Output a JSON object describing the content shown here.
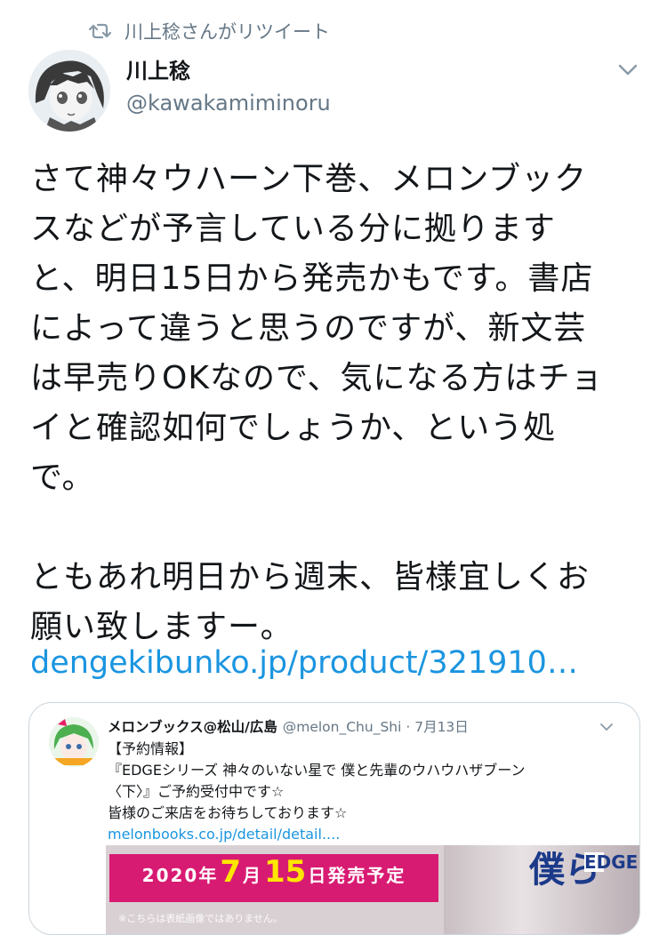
{
  "retweet": {
    "icon": "retweet-icon",
    "text": "川上稔さんがリツイート"
  },
  "author": {
    "name": "川上稔",
    "handle": "@kawakamiminoru",
    "avatar_icon": "anime-avatar"
  },
  "tweet": {
    "lines": [
      "さて神々ウハーン下巻、メロンブック",
      "スなどが予言している分に拠ります",
      "と、明日15日から発売かもです。書店",
      "によって違うと思うのですが、新文芸",
      "は早売りOKなので、気になる方はチョ",
      "イと確認如何でしょうか、という処",
      "で。",
      "",
      "ともあれ明日から週末、皆様宜しくお",
      "願い致しますー。"
    ],
    "link": "dengekibunko.jp/product/321910…"
  },
  "quote": {
    "name": "メロンブックス@松山/広島",
    "meta": "@melon_Chu_Shi · 7月13日",
    "lines": [
      "【予約情報】",
      "『EDGEシリーズ 神々のいない星で 僕と先輩のウハウハザブーン",
      "〈下〉』ご予約受付中です☆",
      "皆様のご来店をお待ちしております☆"
    ],
    "link": "melonbooks.co.jp/detail/detail....",
    "image": {
      "year": "2020年",
      "month": "7",
      "month_unit": "月",
      "day": "15",
      "day_unit": "日発売予定",
      "note": "※こちらは表紙画像ではありません。",
      "title_big": "僕ら",
      "title_small": "EDGE"
    }
  },
  "colors": {
    "accent": "#1b95e0",
    "muted": "#657786",
    "banner": "#d81b72",
    "banner_highlight": "#ffe600"
  }
}
